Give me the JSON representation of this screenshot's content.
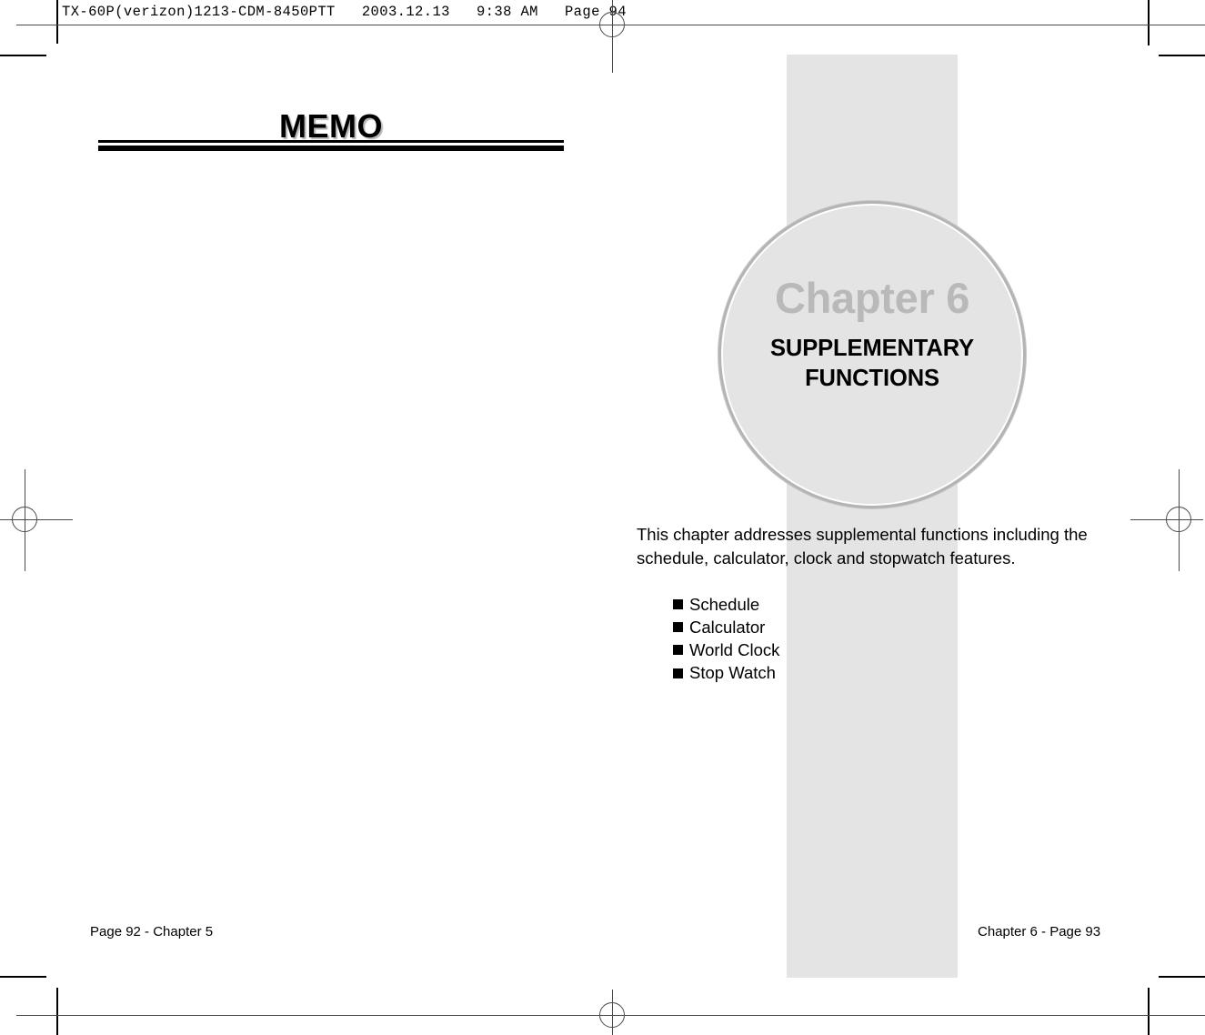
{
  "prepress": {
    "header_line": "TX-60P(verizon)1213-CDM-8450PTT   2003.12.13   9:38 AM   Page 94"
  },
  "left_page": {
    "title": "MEMO",
    "footer": "Page 92 - Chapter 5"
  },
  "right_page": {
    "badge": {
      "chapter_number": "Chapter 6",
      "chapter_name_line1": "SUPPLEMENTARY",
      "chapter_name_line2": "FUNCTIONS"
    },
    "intro": "This chapter addresses supplemental functions including the schedule, calculator, clock and stopwatch features.",
    "features": [
      "Schedule",
      "Calculator",
      "World Clock",
      "Stop Watch"
    ],
    "footer": "Chapter 6 - Page 93"
  },
  "colors": {
    "band_gray": "#e4e4e4",
    "badge_fill": "#e4e4e4",
    "badge_ring": "#b4b4b4",
    "chapter_number_gray": "#b9b9b9",
    "text_black": "#000000",
    "mark_gray": "#4a4a4a"
  }
}
